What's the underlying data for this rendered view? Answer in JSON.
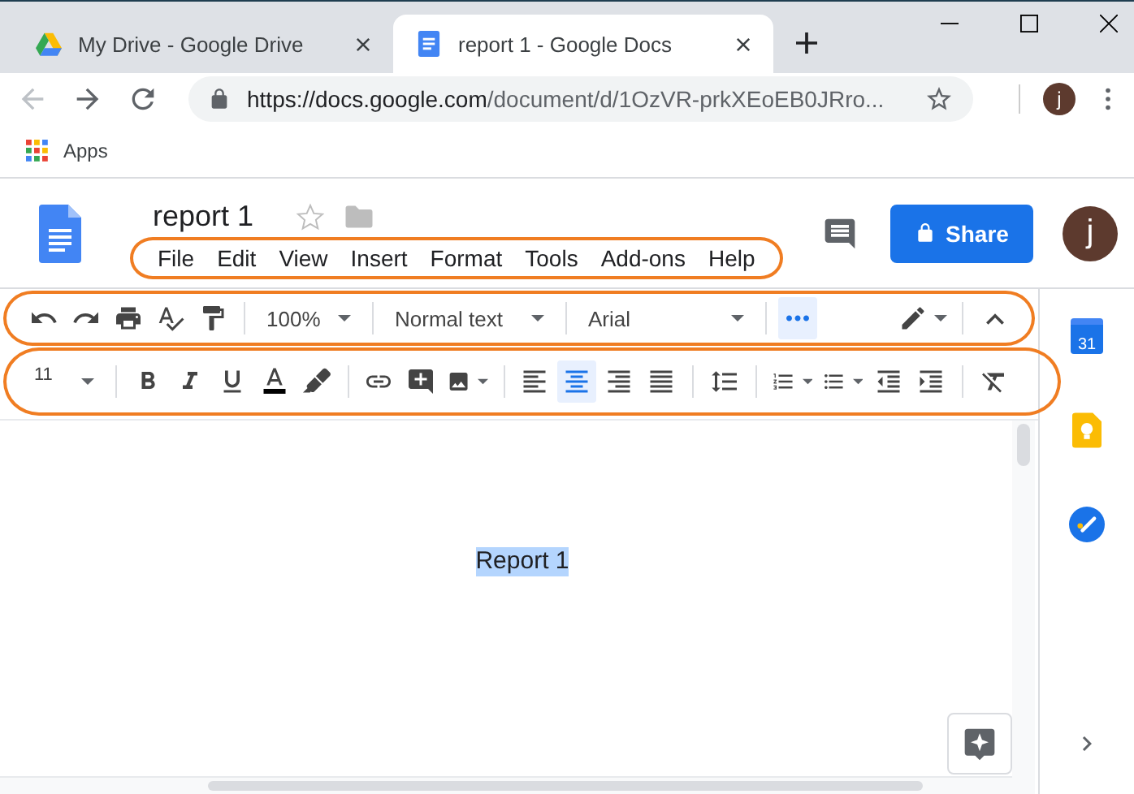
{
  "browser": {
    "tabs": [
      {
        "kind": "drive",
        "title": "My Drive - Google Drive",
        "selected": false
      },
      {
        "kind": "docs",
        "title": "report 1 - Google Docs",
        "selected": true
      }
    ],
    "address_bar": {
      "url_host": "https://docs.google.com",
      "url_path": "/document/d/1OzVR-prkXEoEB0JRro...",
      "back_disabled": true
    },
    "profile_initial": "j",
    "bookmarks": [
      "Apps"
    ]
  },
  "docs_header": {
    "title": "report 1",
    "starred": false,
    "share_label": "Share",
    "account_initial": "j"
  },
  "menu": {
    "highlighted": true,
    "items": [
      "File",
      "Edit",
      "View",
      "Insert",
      "Format",
      "Tools",
      "Add-ons",
      "Help"
    ]
  },
  "toolbar_main": {
    "highlighted": true,
    "items": [
      {
        "kind": "undo"
      },
      {
        "kind": "redo"
      },
      {
        "kind": "print"
      },
      {
        "kind": "spellcheck"
      },
      {
        "kind": "paint-format"
      },
      {
        "kind": "separator"
      },
      {
        "kind": "zoom",
        "label": "100%"
      },
      {
        "kind": "separator"
      },
      {
        "kind": "paragraph-style",
        "label": "Normal text"
      },
      {
        "kind": "separator"
      },
      {
        "kind": "font",
        "label": "Arial"
      },
      {
        "kind": "separator"
      },
      {
        "kind": "more",
        "selected": true
      },
      {
        "kind": "edit-mode",
        "caret": true
      },
      {
        "kind": "separator"
      },
      {
        "kind": "collapse"
      }
    ]
  },
  "toolbar_format": {
    "highlighted": true,
    "items": [
      {
        "kind": "font-size",
        "label": "11"
      },
      {
        "kind": "separator"
      },
      {
        "kind": "bold"
      },
      {
        "kind": "italic"
      },
      {
        "kind": "underline"
      },
      {
        "kind": "text-color"
      },
      {
        "kind": "highlight"
      },
      {
        "kind": "separator"
      },
      {
        "kind": "link"
      },
      {
        "kind": "comment"
      },
      {
        "kind": "image",
        "caret": true
      },
      {
        "kind": "separator"
      },
      {
        "kind": "align-left",
        "selected": false
      },
      {
        "kind": "align-center",
        "selected": true
      },
      {
        "kind": "align-right",
        "selected": false
      },
      {
        "kind": "justify",
        "selected": false
      },
      {
        "kind": "separator"
      },
      {
        "kind": "line-spacing"
      },
      {
        "kind": "separator"
      },
      {
        "kind": "numbered-list",
        "caret": true
      },
      {
        "kind": "bulleted-list",
        "caret": true
      },
      {
        "kind": "indent-less"
      },
      {
        "kind": "indent-more"
      },
      {
        "kind": "separator"
      },
      {
        "kind": "clear-format"
      }
    ]
  },
  "document": {
    "text": "Report 1",
    "selected": true
  },
  "side_panel": [
    {
      "kind": "calendar",
      "label": "31"
    },
    {
      "kind": "keep"
    },
    {
      "kind": "tasks"
    }
  ]
}
